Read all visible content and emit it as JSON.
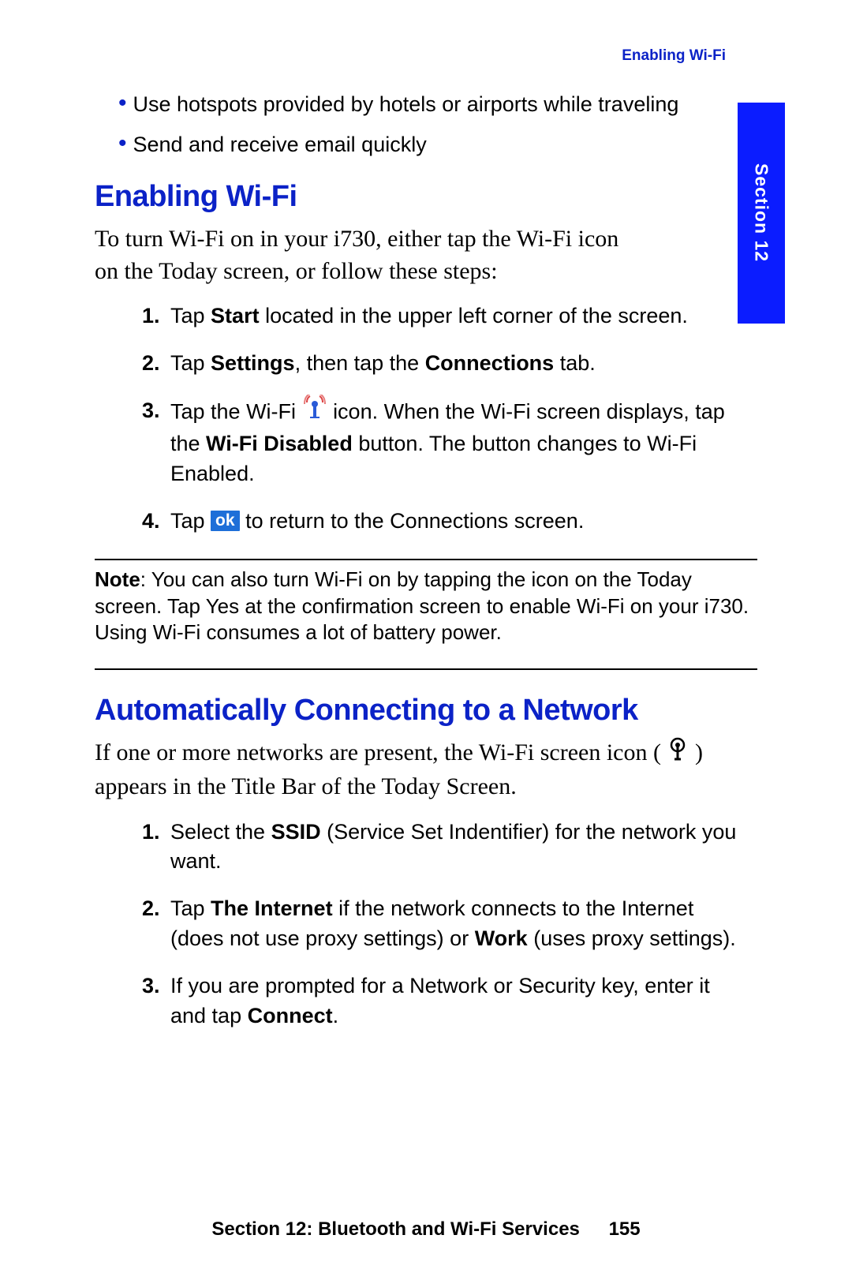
{
  "running_header": "Enabling Wi-Fi",
  "section_tab": "Section 12",
  "bullets": [
    "Use hotspots provided by hotels or airports while traveling",
    "Send and receive email quickly"
  ],
  "heading1": "Enabling Wi-Fi",
  "intro1": "To turn Wi-Fi on in your i730, either tap the Wi-Fi icon on the Today screen, or follow these steps:",
  "step1_a": "Tap ",
  "step1_b": "Start",
  "step1_c": " located in the upper left corner of the screen.",
  "step2_a": "Tap ",
  "step2_b": "Settings",
  "step2_c": ", then tap the ",
  "step2_d": "Connections",
  "step2_e": " tab.",
  "step3_a": "Tap the Wi-Fi ",
  "step3_b": " icon. When the Wi-Fi screen displays, tap the ",
  "step3_c": "Wi-Fi Disabled",
  "step3_d": " button. The button changes to Wi-Fi Enabled.",
  "step4_a": "Tap ",
  "step4_ok": "ok",
  "step4_b": " to return to the Connections screen.",
  "note_label": "Note",
  "note_body": ": You can also turn Wi-Fi on by tapping the icon on the Today screen. Tap Yes at the confirmation screen to enable Wi-Fi on your i730. Using Wi-Fi consumes a lot of battery power.",
  "heading2": "Automatically Connecting to a Network",
  "intro2_a": "If one or more networks are present, the Wi-Fi screen icon ( ",
  "intro2_b": " ) appears in the Title Bar of the Today Screen.",
  "b_step1_a": "Select the ",
  "b_step1_b": "SSID",
  "b_step1_c": " (Service Set Indentifier) for the network you want.",
  "b_step2_a": "Tap ",
  "b_step2_b": "The Internet",
  "b_step2_c": " if the network connects to the Internet (does not use proxy settings) or ",
  "b_step2_d": "Work",
  "b_step2_e": " (uses proxy settings).",
  "b_step3_a": "If you are prompted for a Network or Security key, enter it and tap ",
  "b_step3_b": "Connect",
  "b_step3_c": ".",
  "footer_section": "Section 12: Bluetooth and Wi-Fi Services",
  "footer_page": "155"
}
